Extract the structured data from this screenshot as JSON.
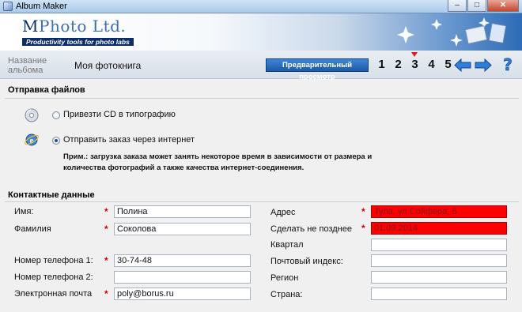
{
  "window": {
    "title": "Album Maker",
    "buttons": [
      "–",
      "□",
      "✕"
    ]
  },
  "banner": {
    "logo_text_a": "M",
    "logo_text_b": "Photo Ltd.",
    "tagline": "Productivity tools for photo labs"
  },
  "nav": {
    "album_name_label": "Название альбома",
    "album_name_value": "Моя фотокнига",
    "preview_button": "Предварительный просмотр",
    "steps": [
      "1",
      "2",
      "3",
      "4",
      "5"
    ],
    "active_step": "3"
  },
  "file_sending": {
    "title": "Отправка файлов",
    "option_cd": "Привезти CD в типографию",
    "option_internet": "Отправить заказ через интернет",
    "selected": "internet",
    "note": "Прим.: загрузка заказа может занять некоторое время в зависимости от размера и количества фотографий а также качества интернет-соединения."
  },
  "contacts": {
    "title": "Контактные данные",
    "left": [
      {
        "label": "Имя:",
        "value": "Полина",
        "required": true
      },
      {
        "label": "Фамилия",
        "value": "Соколова",
        "required": true
      },
      {
        "label": "Номер телефона 1:",
        "value": "30-74-48",
        "required": true
      },
      {
        "label": "Номер телефона 2:",
        "value": "",
        "required": false
      },
      {
        "label": "Электронная почта",
        "value": "poly@borus.ru",
        "required": true
      }
    ],
    "right": [
      {
        "label": "Адрес",
        "value": "Тула, ул.Сойфера, 6",
        "required": true,
        "error": true
      },
      {
        "label": "Сделать не позднее",
        "value": "01.09.2014",
        "required": true,
        "error": true
      },
      {
        "label": "Квартал",
        "value": "",
        "required": false,
        "error": false
      },
      {
        "label": "Почтовый индекс:",
        "value": "",
        "required": false,
        "error": false
      },
      {
        "label": "Регион",
        "value": "",
        "required": false,
        "error": false
      },
      {
        "label": "Страна:",
        "value": "",
        "required": false,
        "error": false
      }
    ],
    "required_mark": "*"
  },
  "colors": {
    "error_field": "#ff0000",
    "required_mark": "#d10000",
    "preview_button": "#1c5aa7"
  }
}
